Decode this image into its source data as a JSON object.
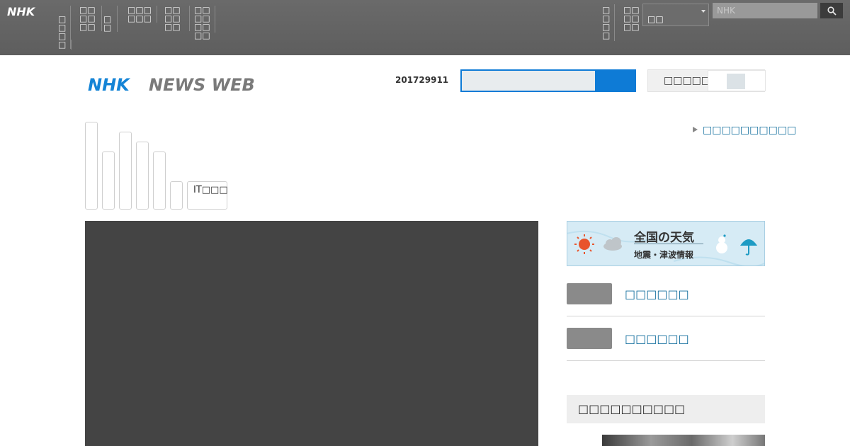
{
  "global_nav": {
    "logo_text": "NHK",
    "items": [
      {
        "label": "□□□□"
      },
      {
        "label": "□□□□□□"
      },
      {
        "label": "□□"
      },
      {
        "label": "□□□□□□"
      },
      {
        "label": "□□□□□□"
      },
      {
        "label": "□□□□□□□□"
      }
    ],
    "right_items": [
      {
        "label": "□□□□"
      },
      {
        "label": "□□□□□□"
      }
    ],
    "region_value": "□□",
    "search_placeholder": "NHK"
  },
  "header": {
    "logo_nhk": "NHK",
    "logo_news": "NEWS WEB",
    "date": "201729911",
    "toggle_label": "□□□□□"
  },
  "tabs": [
    {
      "label": ""
    },
    {
      "label": ""
    },
    {
      "label": ""
    },
    {
      "label": ""
    },
    {
      "label": ""
    },
    {
      "label": ""
    },
    {
      "label": "IT□□□"
    }
  ],
  "more_link": "□□□□□□□□□□",
  "weather": {
    "line1": "全国の天気",
    "line2": "地震・津波情報"
  },
  "side_links": [
    {
      "label": "□□□□□□"
    },
    {
      "label": "□□□□□□"
    }
  ],
  "ranking_title": "□□□□□□□□□□",
  "colors": {
    "topbar": "#666666",
    "brand_blue": "#0e7bd6",
    "link": "#0f6c9c",
    "video_bg": "#444444"
  }
}
